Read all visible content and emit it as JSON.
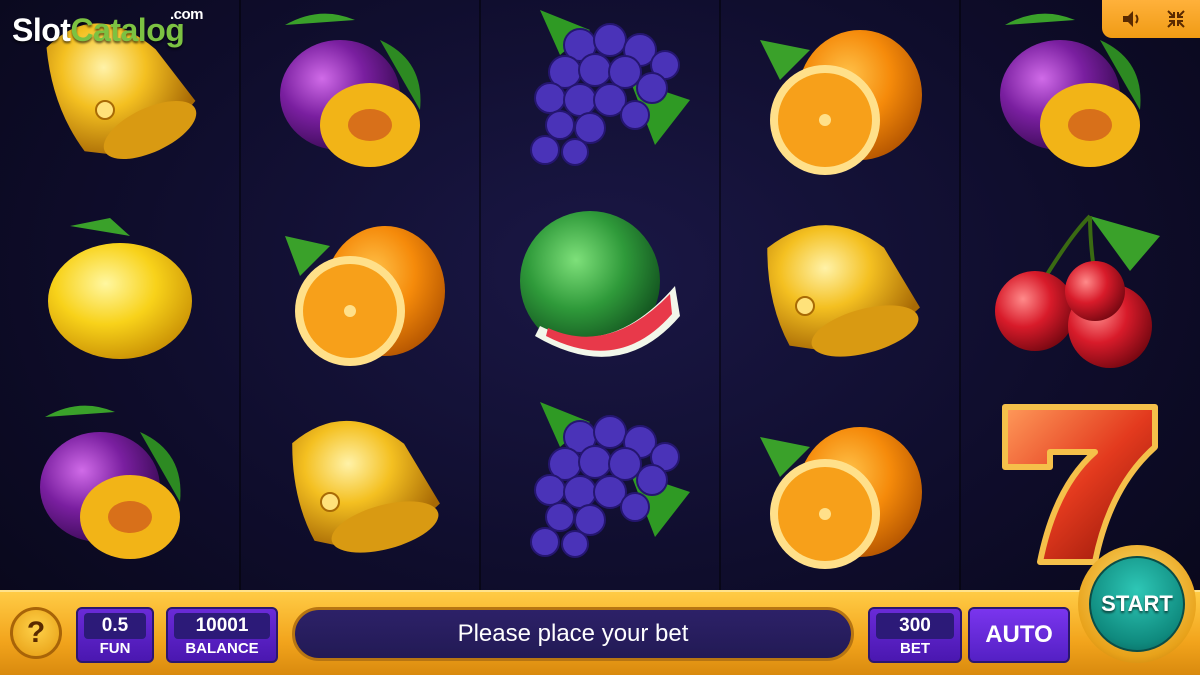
{
  "logo": {
    "brand_part1": "Slot",
    "brand_part2": "Catalog",
    "brand_suffix": ".com"
  },
  "top_controls": {
    "sound_icon": "speaker-icon",
    "exit_fullscreen_icon": "collapse-icon"
  },
  "reels": [
    [
      "bell",
      "lemon",
      "plum"
    ],
    [
      "plum",
      "orange",
      "bell"
    ],
    [
      "grapes",
      "watermelon",
      "grapes"
    ],
    [
      "orange",
      "bell",
      "orange"
    ],
    [
      "plum",
      "cherries",
      "seven"
    ]
  ],
  "bottom_bar": {
    "help_label": "?",
    "coin_value": "0.5",
    "coin_label": "FUN",
    "balance_value": "10001",
    "balance_label": "BALANCE",
    "message": "Please place your bet",
    "bet_value": "300",
    "bet_label": "BET",
    "auto_label": "AUTO",
    "start_label": "START"
  },
  "colors": {
    "bar_gold": "#f2a41c",
    "panel_purple": "#5a22c8",
    "start_teal": "#12a090",
    "background": "#0f0d2c"
  }
}
